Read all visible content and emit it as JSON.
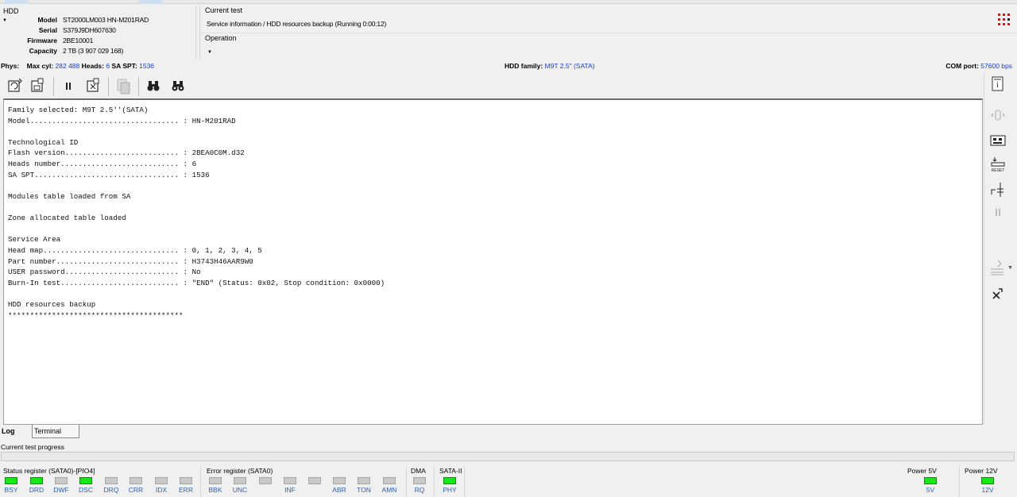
{
  "hdd": {
    "title": "HDD",
    "fields": [
      {
        "label": "Model",
        "value": "ST2000LM003 HN-M201RAD"
      },
      {
        "label": "Serial",
        "value": "S379J9DH607630"
      },
      {
        "label": "Firmware",
        "value": "2BE10001"
      },
      {
        "label": "Capacity",
        "value": "2 TB (3 907 029 168)"
      }
    ]
  },
  "current_test": {
    "title": "Current test",
    "text": "Service information / HDD resources backup (Running 0:00:12)"
  },
  "operation": {
    "title": "Operation"
  },
  "phys": {
    "label": "Phys:",
    "maxcyl_label": "Max cyl:",
    "maxcyl_value": "282 488",
    "heads_label": "Heads:",
    "heads_value": "6",
    "saspt_label": "SA SPT:",
    "saspt_value": "1536",
    "family_label": "HDD family:",
    "family_value": "M9T 2.5\" (SATA)",
    "com_label": "COM port:",
    "com_value": "57600 bps"
  },
  "log_lines": [
    "Family selected: M9T 2.5''(SATA)",
    "Model.................................. : HN-M201RAD",
    "",
    "Technological ID",
    "Flash version.......................... : 2BEA0C0M.d32",
    "Heads number........................... : 6",
    "SA SPT................................. : 1536",
    "",
    "Modules table loaded from SA",
    "",
    "Zone allocated table loaded",
    "",
    "Service Area",
    "Head map............................... : 0, 1, 2, 3, 4, 5",
    "Part number............................ : H3743H46AAR9W0",
    "USER password.......................... : No",
    "Burn-In test........................... : \"END\" (Status: 0x02, Stop condition: 0x0000)",
    "",
    "HDD resources backup",
    "****************************************"
  ],
  "tabs": {
    "log": "Log",
    "terminal": "Terminal"
  },
  "progress": {
    "label": "Current test progress",
    "value": 0
  },
  "status_register": {
    "title": "Status register (SATA0)-[PIO4]",
    "leds": [
      {
        "name": "BSY",
        "on": true
      },
      {
        "name": "DRD",
        "on": true
      },
      {
        "name": "DWF",
        "on": false
      },
      {
        "name": "DSC",
        "on": true
      },
      {
        "name": "DRQ",
        "on": false
      },
      {
        "name": "CRR",
        "on": false
      },
      {
        "name": "IDX",
        "on": false
      },
      {
        "name": "ERR",
        "on": false
      }
    ]
  },
  "error_register": {
    "title": "Error register (SATA0)",
    "leds": [
      {
        "name": "BBK",
        "on": false
      },
      {
        "name": "UNC",
        "on": false
      },
      {
        "name": "",
        "on": false
      },
      {
        "name": "INF",
        "on": false
      },
      {
        "name": "",
        "on": false
      },
      {
        "name": "ABR",
        "on": false
      },
      {
        "name": "TON",
        "on": false
      },
      {
        "name": "AMN",
        "on": false
      }
    ]
  },
  "dma": {
    "title": "DMA",
    "leds": [
      {
        "name": "RQ",
        "on": false
      }
    ]
  },
  "sata": {
    "title": "SATA-II",
    "leds": [
      {
        "name": "PHY",
        "on": true
      }
    ]
  },
  "power5": {
    "title": "Power 5V",
    "leds": [
      {
        "name": "5V",
        "on": true
      }
    ]
  },
  "power12": {
    "title": "Power 12V",
    "leds": [
      {
        "name": "12V",
        "on": true
      }
    ]
  },
  "colors": {
    "accent_blue": "#1a3ec8",
    "led_on": "#17e617",
    "led_off": "#c9c9c9"
  }
}
